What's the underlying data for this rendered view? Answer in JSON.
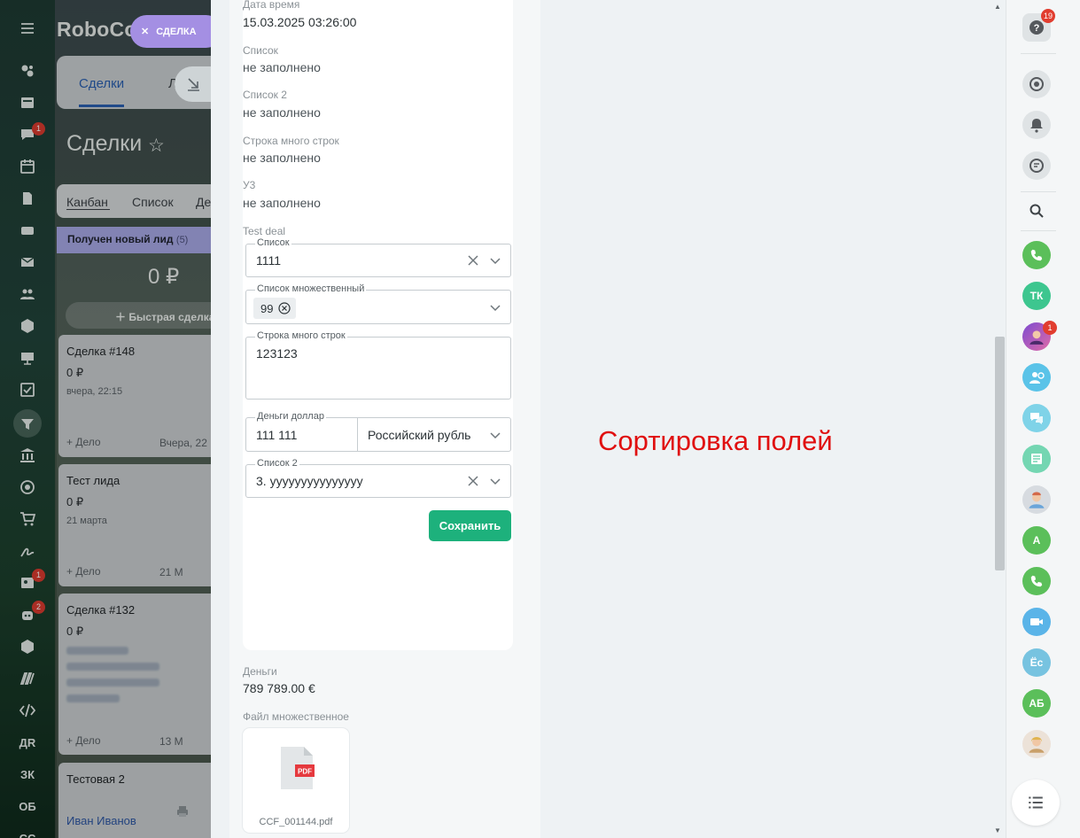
{
  "app": {
    "brand": "RoboCo"
  },
  "left_rail": {
    "badges": {
      "chat": "1",
      "contact_center": "1",
      "robots": "2"
    },
    "text_items": [
      "ДR",
      "ЗК",
      "ОБ",
      "СС"
    ]
  },
  "background": {
    "tabs": {
      "deals": "Сделки",
      "leads": "Л"
    },
    "page_title": "Сделки",
    "views": [
      "Канбан",
      "Список",
      "Де"
    ],
    "stage": {
      "name": "Получен новый лид",
      "count": "(5)",
      "sum": "0 ₽",
      "quick_add": "Быстрая сделка"
    },
    "cards": [
      {
        "title": "Сделка #148",
        "sum": "0 ₽",
        "date": "вчера, 22:15",
        "task": "+ Дело",
        "right": "Вчера, 22"
      },
      {
        "title": "Тест лида",
        "sum": "0 ₽",
        "date": "21 марта",
        "task": "+ Дело",
        "right": "21 М"
      },
      {
        "title": "Сделка #132",
        "sum": "0 ₽",
        "date": "",
        "task": "+ Дело",
        "right": "13 М"
      },
      {
        "title": "Тестовая 2",
        "sum": "",
        "person": "Иван Иванов",
        "date": "",
        "task": "",
        "right": ""
      }
    ],
    "pill": "СДЕЛКА"
  },
  "form": {
    "fields": [
      {
        "label": "Дата время",
        "value": "15.03.2025 03:26:00"
      },
      {
        "label": "Список",
        "value": "не заполнено"
      },
      {
        "label": "Список 2",
        "value": "не заполнено"
      },
      {
        "label": "Строка много строк",
        "value": "не заполнено"
      },
      {
        "label": "У3",
        "value": "не заполнено"
      }
    ],
    "section_label": "Test deal",
    "edit": {
      "list": {
        "label": "Список",
        "value": "1111"
      },
      "multi_list": {
        "label": "Список множественный",
        "chip": "99"
      },
      "multiline": {
        "label": "Строка много строк",
        "value": "123123"
      },
      "money": {
        "label": "Деньги доллар",
        "value": "111 111",
        "currency": "Российский рубль"
      },
      "list2": {
        "label": "Список 2",
        "value": "3. yyyyyyyyyyyyyyy"
      }
    },
    "save_label": "Сохранить",
    "money_field": {
      "label": "Деньги",
      "value": "789 789.00 €"
    },
    "files_field": {
      "label": "Файл множественное",
      "file_name": "CCF_001144.pdf",
      "file_type": "PDF"
    }
  },
  "annotation": "Сортировка полей",
  "right_rail": {
    "help_badge": "19",
    "avatar_badge": "1",
    "avatars": [
      {
        "initials": "ТК",
        "color": "#3dc68f"
      },
      {
        "initials": "А",
        "color": "#5bbf5a"
      },
      {
        "initials": "Ёс",
        "color": "#77c3e0"
      },
      {
        "initials": "АБ",
        "color": "#5bbf5a"
      }
    ]
  }
}
